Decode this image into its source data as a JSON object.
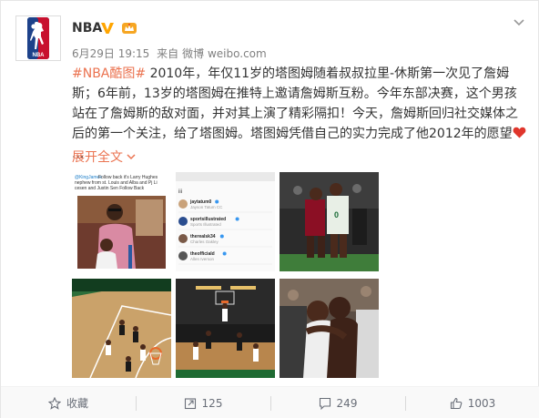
{
  "post": {
    "username": "NBA",
    "date": "6月29日 19:15",
    "source_prefix": "来自",
    "source": "微博 weibo.com",
    "hashtag": "#NBA酷图#",
    "text": " 2010年，年仅11岁的塔图姆随着叔叔拉里-休斯第一次见了詹姆斯；6年前，13岁的塔图姆在推特上邀请詹姆斯互粉。今年东部决赛，这个男孩站在了詹姆斯的敌对面，并对其上演了精彩隔扣！今天，詹姆斯回归社交媒体之后的第一个关注，给了塔图姆。塔图姆凭借自己的实力完成了他2012年的愿望",
    "ellipsis": " ...",
    "expand_label": "展开全文"
  },
  "images": {
    "tweet": {
      "mention": "@KingJames",
      "line1": " Follow back it's Larry Hughes",
      "line2": "nephew from st. Louis and Alba and Pj Li",
      "line3": "cesen and Justin Sen Follow Back"
    },
    "follow_list": {
      "header": "iii",
      "users": [
        {
          "handle": "jaytatum0",
          "name": "Jayson Tatum CC"
        },
        {
          "handle": "sportsillustrated",
          "name": "Sports Illustrated"
        },
        {
          "handle": "therealsk34",
          "name": "Charles Oakley"
        },
        {
          "handle": "theofficiald",
          "name": "Allen Iverson"
        }
      ]
    }
  },
  "actions": {
    "favorite_label": "收藏",
    "repost_count": "125",
    "comment_count": "249",
    "like_count": "1003"
  },
  "colors": {
    "link": "#eb7350",
    "verified": "#ffa500",
    "heart": "#e0362c"
  }
}
